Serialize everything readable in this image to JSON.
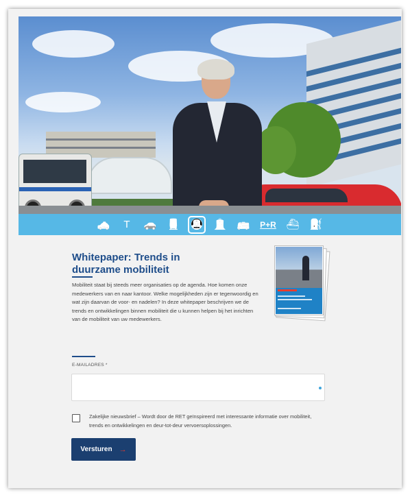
{
  "hero": {
    "alt_subject": "",
    "icons": [
      {
        "name": "taxi-icon",
        "glyph": "🚕"
      },
      {
        "name": "walking-sign-icon",
        "glyph": "T"
      },
      {
        "name": "car-icon",
        "glyph": "🚗"
      },
      {
        "name": "train-icon",
        "glyph": "🚆"
      },
      {
        "name": "metro-icon",
        "glyph": "🚇"
      },
      {
        "name": "tram-icon",
        "glyph": "🚊"
      },
      {
        "name": "bus-icon",
        "glyph": "🚌"
      },
      {
        "name": "park-and-ride-icon",
        "glyph": "P+R"
      },
      {
        "name": "ferry-icon",
        "glyph": "⛴"
      },
      {
        "name": "fuel-pump-icon",
        "glyph": "⛽"
      }
    ],
    "active_icon": "metro-icon"
  },
  "content": {
    "title": "Whitepaper: Trends in duurzame mobiliteit",
    "intro": "Mobiliteit staat bij steeds meer organisaties op de agenda. Hoe komen onze medewerkers van en naar kantoor. Welke mogelijkheden zijn er tegenwoordig en wat zijn daarvan de voor- en nadelen? In deze whitepaper beschrijven we de trends en ontwikkelingen binnen mobiliteit die u kunnen helpen bij het inrichten van de mobiliteit van uw medewerkers."
  },
  "form": {
    "email_label": "E-MAILADRES *",
    "email_value": "",
    "newsletter_checked": false,
    "newsletter_text": "Zakelijke nieuwsbrief – Wordt door de RET geïnspireerd met interessante informatie over mobiliteit, trends en ontwikkelingen en deur-tot-deur vervoersoplossingen.",
    "submit_label": "Versturen",
    "submit_arrow": "→"
  },
  "colors": {
    "icon_bar": "#56b8e6",
    "title": "#1e4d8a",
    "button": "#1b3f70",
    "accent_red": "#e63c2f"
  }
}
